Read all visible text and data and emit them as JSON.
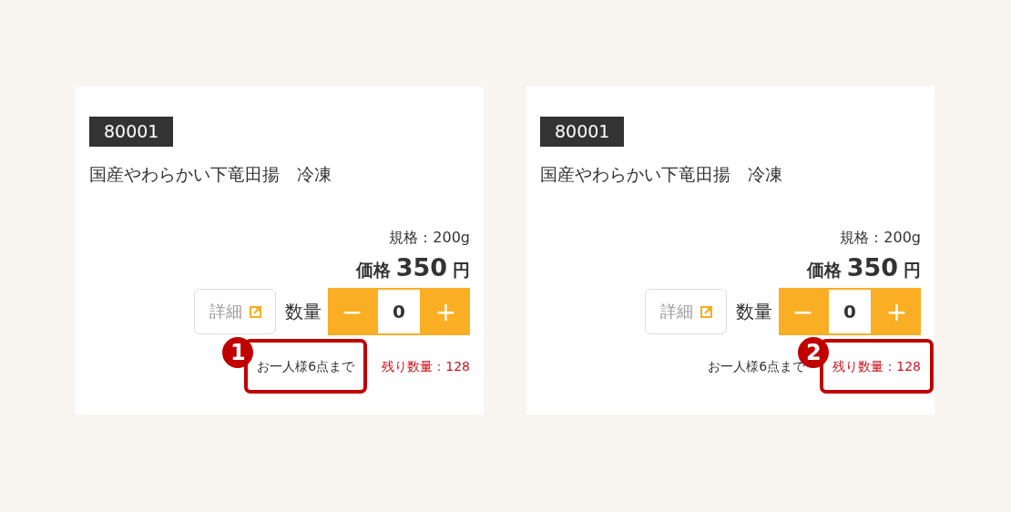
{
  "cards": [
    {
      "code": "80001",
      "name": "国産やわらかい下竜田揚　冷凍",
      "spec": "規格：200g",
      "price_label": "価格",
      "price": "350",
      "currency": "円",
      "detail_button": "詳細",
      "quantity_label": "数量",
      "minus": "−",
      "quantity": "0",
      "plus": "+",
      "limit": {
        "text": "お一人様6点まで",
        "annotation": "1"
      },
      "stock": {
        "text": "残り数量：128"
      }
    },
    {
      "code": "80001",
      "name": "国産やわらかい下竜田揚　冷凍",
      "spec": "規格：200g",
      "price_label": "価格",
      "price": "350",
      "currency": "円",
      "detail_button": "詳細",
      "quantity_label": "数量",
      "minus": "−",
      "quantity": "0",
      "plus": "+",
      "limit": {
        "text": "お一人様6点まで"
      },
      "stock": {
        "text": "残り数量：128",
        "annotation": "2"
      }
    }
  ]
}
